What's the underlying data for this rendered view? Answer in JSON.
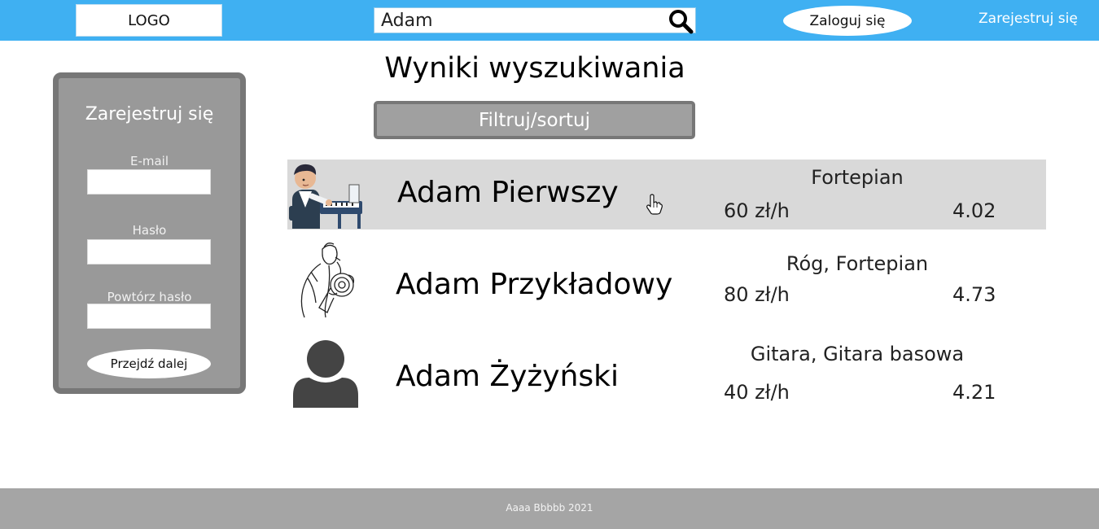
{
  "header": {
    "logo": "LOGO",
    "search_value": "Adam",
    "search_icon": "search-icon",
    "login_label": "Zaloguj się",
    "register_label": "Zarejestruj się"
  },
  "sidebar": {
    "title": "Zarejestruj się",
    "email_label": "E-mail",
    "password_label": "Hasło",
    "repeat_password_label": "Powtórz hasło",
    "submit_label": "Przejdź dalej"
  },
  "main": {
    "title": "Wyniki wyszukiwania",
    "filter_label": "Filtruj/sortuj",
    "results": [
      {
        "name": "Adam Pierwszy",
        "instruments": "Fortepian",
        "price": "60 zł/h",
        "rating": "4.02",
        "avatar": "pianist-avatar"
      },
      {
        "name": "Adam Przykładowy",
        "instruments": "Róg, Fortepian",
        "price": "80 zł/h",
        "rating": "4.73",
        "avatar": "horn-player-avatar"
      },
      {
        "name": "Adam Żyżyński",
        "instruments": "Gitara, Gitara basowa",
        "price": "40 zł/h",
        "rating": "4.21",
        "avatar": "default-user-avatar"
      }
    ]
  },
  "footer": {
    "text": "Aaaa Bbbbb 2021"
  },
  "colors": {
    "header_bg": "#3fb0f2",
    "sidebar_bg": "#999999",
    "sidebar_border": "#777777",
    "highlight_row": "#d9d9d9",
    "footer_bg": "#a5a5a5"
  }
}
